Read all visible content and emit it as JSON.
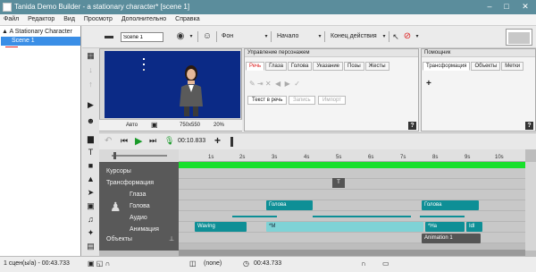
{
  "window": {
    "title": "Tanida Demo Builder - a stationary character* [scene 1]",
    "controls": {
      "minimize": "–",
      "maximize": "□",
      "close": "✕"
    }
  },
  "menu": [
    "Файл",
    "Редактор",
    "Вид",
    "Просмотр",
    "Дополнительно",
    "Справка"
  ],
  "tree": {
    "root": "▲ A Stationary Character",
    "scene": "Scene 1"
  },
  "toolbar": {
    "scene_name": "Scene 1",
    "background_label": "Фон",
    "start_label": "Начало",
    "end_action_label": "Конец действия"
  },
  "stage": {
    "mode": "Авто",
    "size": "750x550",
    "zoom": "20%"
  },
  "char_panel": {
    "title": "Управление персонажем",
    "tabs": [
      "Речь",
      "Глаза",
      "Голова",
      "Указание",
      "Позы",
      "Жесты"
    ],
    "speech_tab": "Текст в речь",
    "record_tab": "Запись",
    "import_tab": "Импорт",
    "help": "?"
  },
  "helper_panel": {
    "title": "Помощник",
    "tabs": [
      "Трансформация",
      "Объекты",
      "Метки"
    ],
    "add": "+",
    "help": "?"
  },
  "timeline": {
    "time": "00:10.833",
    "ticks": [
      "1s",
      "2s",
      "3s",
      "4s",
      "5s",
      "6s",
      "7s",
      "8s",
      "9s",
      "10s"
    ],
    "tracks": {
      "cursors": "Курсоры",
      "transform": "Трансформация",
      "eyes": "Глаза",
      "head": "Голова",
      "audio": "Аудио",
      "animation": "Анимация",
      "objects": "Объекты"
    },
    "clips": {
      "transform_marker": "T",
      "head1": "Голова",
      "head2": "Голова",
      "waving": "Waving",
      "anim_m": "*M",
      "anim_ha": "*На",
      "anim_idl": "Idl",
      "animation1": "Animation 1"
    }
  },
  "status": {
    "scenes": "1 сцен(ы/а) - 00:43.733",
    "none": "(none)",
    "time": "00:43.733"
  },
  "colors": {
    "titlebar": "#5b8d9c",
    "stage": "#0b2a86",
    "clip": "#0e8f96",
    "green_bar": "#19e02c",
    "selection": "#3a8ee6"
  }
}
